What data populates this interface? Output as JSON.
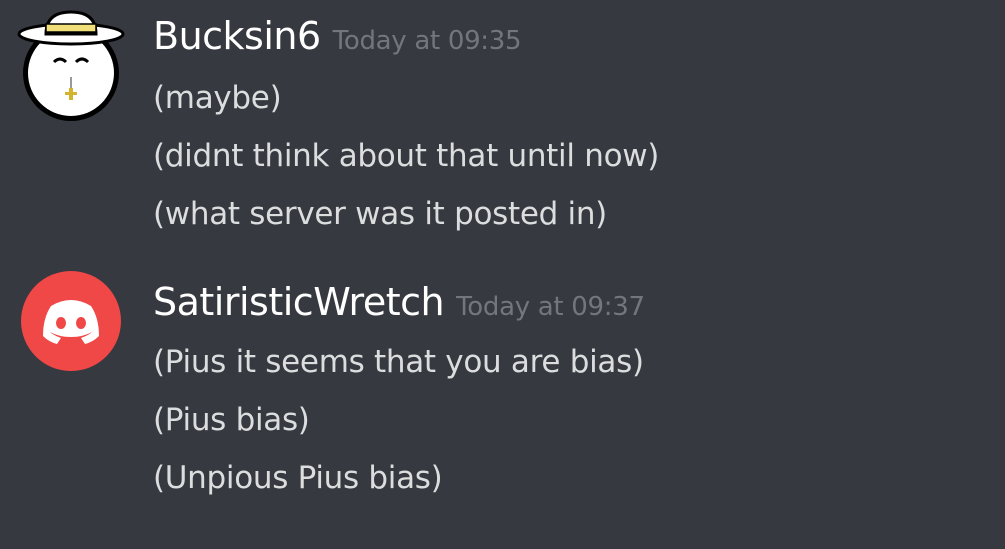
{
  "messages": [
    {
      "username": "Bucksin6",
      "timestamp": "Today at 09:35",
      "avatar_icon": "pope-hat-avatar-icon",
      "lines": [
        "(maybe)",
        "(didnt think about that until now)",
        "(what server was it posted in)"
      ]
    },
    {
      "username": "SatiristicWretch",
      "timestamp": "Today at 09:37",
      "avatar_icon": "discord-logo-icon",
      "avatar_color": "#f04747",
      "lines": [
        "(Pius it seems that you are bias)",
        "(Pius bias)",
        "(Unpious Pius bias)"
      ]
    }
  ]
}
